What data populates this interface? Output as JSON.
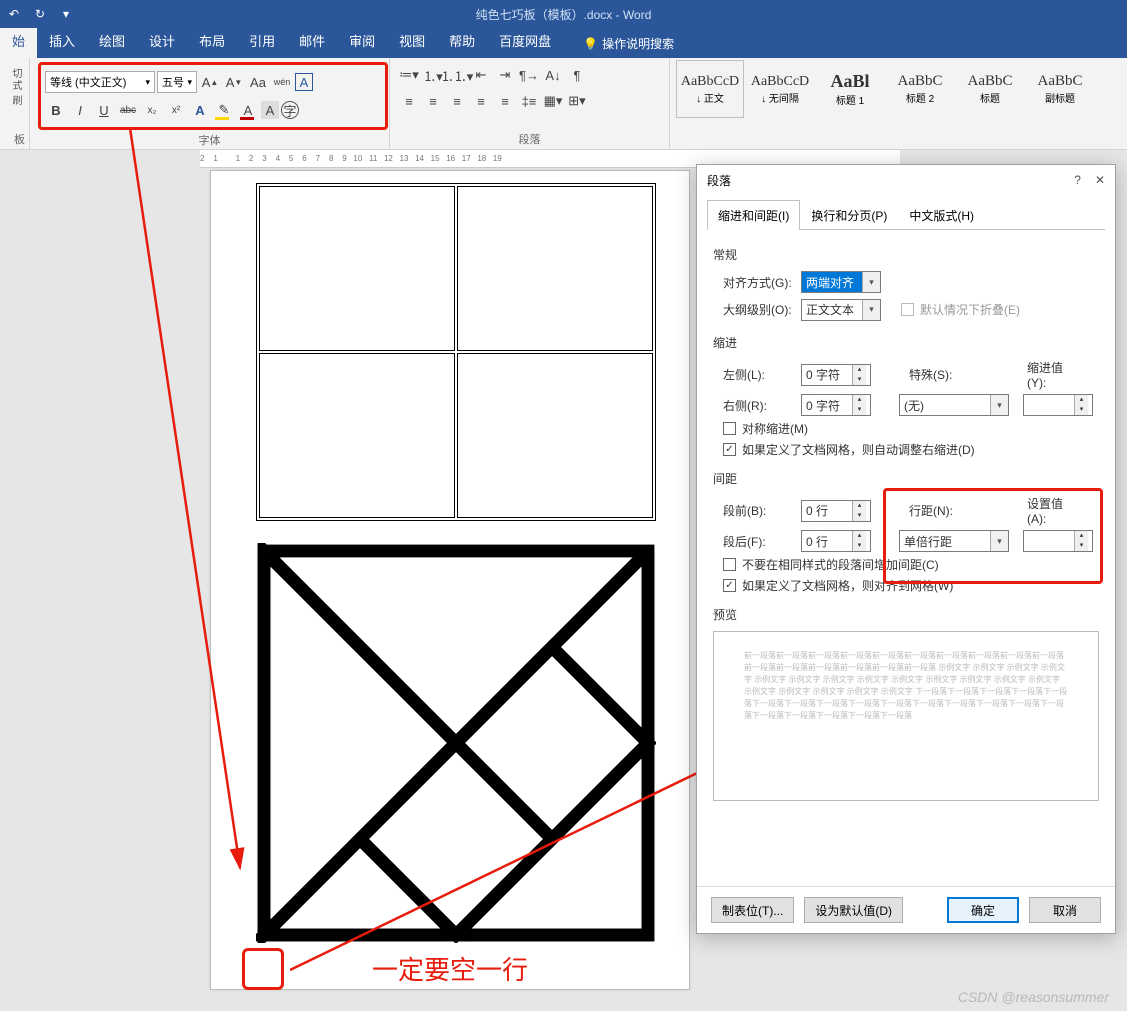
{
  "titlebar": {
    "doc_title": "纯色七巧板（模板）.docx - Word"
  },
  "tabs": {
    "t0": "始",
    "t1": "插入",
    "t2": "绘图",
    "t3": "设计",
    "t4": "布局",
    "t5": "引用",
    "t6": "邮件",
    "t7": "审阅",
    "t8": "视图",
    "t9": "帮助",
    "t10": "百度网盘",
    "tell": "操作说明搜索"
  },
  "clip": {
    "l1": "切",
    "l2": "式刷",
    "grp": "板"
  },
  "font": {
    "name": "等线 (中文正文)",
    "size": "五号",
    "grp_title": "字体",
    "btn_bold": "B",
    "btn_italic": "I",
    "btn_under": "U",
    "btn_strike": "abc",
    "btn_sub": "x₂",
    "btn_sup": "x²"
  },
  "para": {
    "grp_title": "段落"
  },
  "styles": {
    "s0p": "AaBbCcD",
    "s0l": "↓ 正文",
    "s1p": "AaBbCcD",
    "s1l": "↓ 无间隔",
    "s2p": "AaBl",
    "s2l": "标题 1",
    "s3p": "AaBbC",
    "s3l": "标题 2",
    "s4p": "AaBbC",
    "s4l": "标题",
    "s5p": "AaBbC",
    "s5l": "副标题"
  },
  "dialog": {
    "title": "段落",
    "tab1": "缩进和间距(I)",
    "tab2": "换行和分页(P)",
    "tab3": "中文版式(H)",
    "sec_general": "常规",
    "lbl_align": "对齐方式(G):",
    "val_align": "两端对齐",
    "lbl_outline": "大纲级别(O):",
    "val_outline": "正文文本",
    "chk_collapse": "默认情况下折叠(E)",
    "sec_indent": "缩进",
    "lbl_left": "左侧(L):",
    "val_left": "0 字符",
    "lbl_right": "右侧(R):",
    "val_right": "0 字符",
    "lbl_special": "特殊(S):",
    "val_special": "(无)",
    "lbl_indval": "缩进值(Y):",
    "chk_mirror": "对称缩进(M)",
    "chk_autoadj": "如果定义了文档网格，则自动调整右缩进(D)",
    "sec_spacing": "间距",
    "lbl_before": "段前(B):",
    "val_before": "0 行",
    "lbl_after": "段后(F):",
    "val_after": "0 行",
    "lbl_linesp": "行距(N):",
    "val_linesp": "单倍行距",
    "lbl_setval": "设置值(A):",
    "chk_nospace": "不要在相同样式的段落间增加间距(C)",
    "chk_snapgrid": "如果定义了文档网格，则对齐到网格(W)",
    "sec_preview": "预览",
    "preview_text": "前一段落前一段落前一段落前一段落前一段落前一段落前一段落前一段落前一段落前一段落前一段落前一段落前一段落前一段落前一段落前一段落 示例文字 示例文字 示例文字 示例文字 示例文字 示例文字 示例文字 示例文字 示例文字 示例文字 示例文字 示例文字 示例文字 示例文字 示例文字 示例文字 示例文字 示例文字 下一段落下一段落下一段落下一段落下一段落下一段落下一段落下一段落下一段落下一段落下一段落下一段落下一段落下一段落下一段落下一段落下一段落下一段落下一段落下一段落",
    "btn_tabs": "制表位(T)...",
    "btn_default": "设为默认值(D)",
    "btn_ok": "确定",
    "btn_cancel": "取消"
  },
  "annotation": "一定要空一行",
  "ruler": "2    1        1    2    3    4    5    6    7    8    9   10   11   12   13   14   15   16   17   18   19",
  "watermark": "CSDN @reasonsummer"
}
